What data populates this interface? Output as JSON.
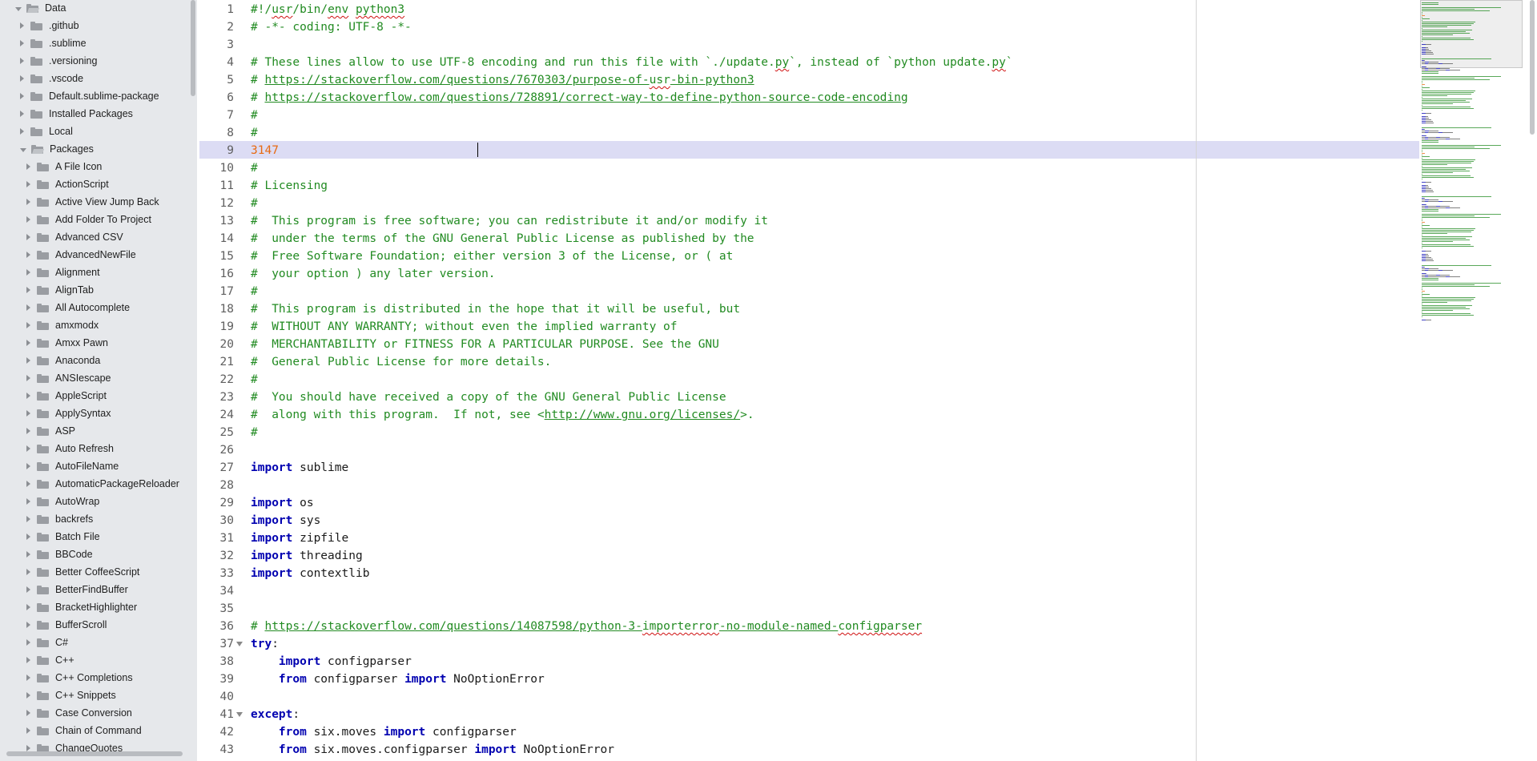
{
  "sidebar": {
    "root": "Data",
    "folders": [
      ".github",
      ".sublime",
      ".versioning",
      ".vscode",
      "Default.sublime-package",
      "Installed Packages",
      "Local",
      "Packages"
    ],
    "packages": [
      "A File Icon",
      "ActionScript",
      "Active View Jump Back",
      "Add Folder To Project",
      "Advanced CSV",
      "AdvancedNewFile",
      "Alignment",
      "AlignTab",
      "All Autocomplete",
      "amxmodx",
      "Amxx Pawn",
      "Anaconda",
      "ANSIescape",
      "AppleScript",
      "ApplySyntax",
      "ASP",
      "Auto Refresh",
      "AutoFileName",
      "AutomaticPackageReloader",
      "AutoWrap",
      "backrefs",
      "Batch File",
      "BBCode",
      "Better CoffeeScript",
      "BetterFindBuffer",
      "BracketHighlighter",
      "BufferScroll",
      "C#",
      "C++",
      "C++ Completions",
      "C++ Snippets",
      "Case Conversion",
      "Chain of Command",
      "ChangeQuotes"
    ]
  },
  "editor": {
    "line_numbers": [
      "1",
      "2",
      "3",
      "4",
      "5",
      "6",
      "7",
      "8",
      "9",
      "10",
      "11",
      "12",
      "13",
      "14",
      "15",
      "16",
      "17",
      "18",
      "19",
      "20",
      "21",
      "22",
      "23",
      "24",
      "25",
      "26",
      "27",
      "28",
      "29",
      "30",
      "31",
      "32",
      "33",
      "34",
      "35",
      "36",
      "37",
      "38",
      "39",
      "40",
      "41",
      "42",
      "43"
    ],
    "current_line": 9,
    "lines": [
      [
        {
          "t": "c",
          "v": "#!/"
        },
        {
          "t": "c sq",
          "v": "usr"
        },
        {
          "t": "c",
          "v": "/bin/"
        },
        {
          "t": "c sq",
          "v": "env"
        },
        {
          "t": "c",
          "v": " "
        },
        {
          "t": "c sq",
          "v": "python3"
        }
      ],
      [
        {
          "t": "c",
          "v": "# -*- coding: UTF-8 -*-"
        }
      ],
      [],
      [
        {
          "t": "c",
          "v": "# These lines allow to use UTF-8 encoding and run this file with `./update."
        },
        {
          "t": "c sq",
          "v": "py"
        },
        {
          "t": "c",
          "v": "`, instead of `python update."
        },
        {
          "t": "c sq",
          "v": "py"
        },
        {
          "t": "c",
          "v": "`"
        }
      ],
      [
        {
          "t": "c",
          "v": "# "
        },
        {
          "t": "u",
          "v": "https://stackoverflow.com/questions/7670303/purpose-of-"
        },
        {
          "t": "u sq",
          "v": "usr"
        },
        {
          "t": "u",
          "v": "-bin-python3"
        }
      ],
      [
        {
          "t": "c",
          "v": "# "
        },
        {
          "t": "u",
          "v": "https://stackoverflow.com/questions/728891/correct-way-to-define-python-source-code-encoding"
        }
      ],
      [
        {
          "t": "c",
          "v": "#"
        }
      ],
      [
        {
          "t": "c",
          "v": "#"
        }
      ],
      [
        {
          "t": "num",
          "v": "3147"
        }
      ],
      [
        {
          "t": "c",
          "v": "#"
        }
      ],
      [
        {
          "t": "c",
          "v": "# Licensing"
        }
      ],
      [
        {
          "t": "c",
          "v": "#"
        }
      ],
      [
        {
          "t": "c",
          "v": "#  This program is free software; you can redistribute it and/or modify it"
        }
      ],
      [
        {
          "t": "c",
          "v": "#  under the terms of the GNU General Public License as published by the"
        }
      ],
      [
        {
          "t": "c",
          "v": "#  Free Software Foundation; either version 3 of the License, or ( at"
        }
      ],
      [
        {
          "t": "c",
          "v": "#  your option ) any later version."
        }
      ],
      [
        {
          "t": "c",
          "v": "#"
        }
      ],
      [
        {
          "t": "c",
          "v": "#  This program is distributed in the hope that it will be useful, but"
        }
      ],
      [
        {
          "t": "c",
          "v": "#  WITHOUT ANY WARRANTY; without even the implied warranty of"
        }
      ],
      [
        {
          "t": "c",
          "v": "#  MERCHANTABILITY or FITNESS FOR A PARTICULAR PURPOSE. See the GNU"
        }
      ],
      [
        {
          "t": "c",
          "v": "#  General Public License for more details."
        }
      ],
      [
        {
          "t": "c",
          "v": "#"
        }
      ],
      [
        {
          "t": "c",
          "v": "#  You should have received a copy of the GNU General Public License"
        }
      ],
      [
        {
          "t": "c",
          "v": "#  along with this program.  If not, see <"
        },
        {
          "t": "u",
          "v": "http://www.gnu.org/licenses/"
        },
        {
          "t": "c",
          "v": ">."
        }
      ],
      [
        {
          "t": "c",
          "v": "#"
        }
      ],
      [],
      [
        {
          "t": "k",
          "v": "import"
        },
        {
          "t": "n",
          "v": " sublime"
        }
      ],
      [],
      [
        {
          "t": "k",
          "v": "import"
        },
        {
          "t": "n",
          "v": " os"
        }
      ],
      [
        {
          "t": "k",
          "v": "import"
        },
        {
          "t": "n",
          "v": " sys"
        }
      ],
      [
        {
          "t": "k",
          "v": "import"
        },
        {
          "t": "n",
          "v": " zipfile"
        }
      ],
      [
        {
          "t": "k",
          "v": "import"
        },
        {
          "t": "n",
          "v": " threading"
        }
      ],
      [
        {
          "t": "k",
          "v": "import"
        },
        {
          "t": "n",
          "v": " contextlib"
        }
      ],
      [],
      [],
      [
        {
          "t": "c",
          "v": "# "
        },
        {
          "t": "u",
          "v": "https://stackoverflow.com/questions/14087598/python-3-"
        },
        {
          "t": "u sq",
          "v": "importerror"
        },
        {
          "t": "u",
          "v": "-no-module-named-"
        },
        {
          "t": "u sq",
          "v": "configparser"
        }
      ],
      [
        {
          "t": "k",
          "v": "try"
        },
        {
          "t": "n",
          "v": ":"
        }
      ],
      [
        {
          "t": "n",
          "v": "    "
        },
        {
          "t": "k",
          "v": "import"
        },
        {
          "t": "n",
          "v": " configparser"
        }
      ],
      [
        {
          "t": "n",
          "v": "    "
        },
        {
          "t": "k",
          "v": "from"
        },
        {
          "t": "n",
          "v": " configparser "
        },
        {
          "t": "k",
          "v": "import"
        },
        {
          "t": "n",
          "v": " NoOptionError"
        }
      ],
      [],
      [
        {
          "t": "k",
          "v": "except"
        },
        {
          "t": "n",
          "v": ":"
        }
      ],
      [
        {
          "t": "n",
          "v": "    "
        },
        {
          "t": "k",
          "v": "from"
        },
        {
          "t": "n",
          "v": " six.moves "
        },
        {
          "t": "k",
          "v": "import"
        },
        {
          "t": "n",
          "v": " configparser"
        }
      ],
      [
        {
          "t": "n",
          "v": "    "
        },
        {
          "t": "k",
          "v": "from"
        },
        {
          "t": "n",
          "v": " six.moves.configparser "
        },
        {
          "t": "k",
          "v": "import"
        },
        {
          "t": "n",
          "v": " NoOptionError"
        }
      ]
    ],
    "fold_lines": [
      37,
      41
    ]
  },
  "colors": {
    "comment": "#228b22",
    "keyword": "#0000b0",
    "number": "#e76a12",
    "current_line_bg": "#dcdcf4",
    "sidebar_bg": "#e6e8eb"
  },
  "icons": {
    "folder": "folder-icon",
    "folder_open": "folder-open-icon",
    "collapsed": "disclosure-right-icon",
    "expanded": "disclosure-down-icon"
  }
}
